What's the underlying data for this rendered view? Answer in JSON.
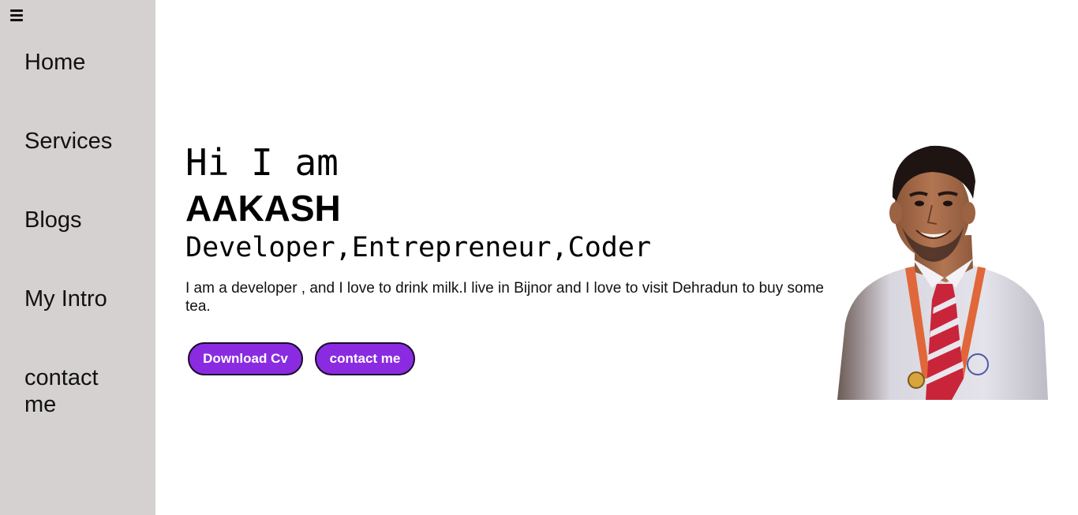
{
  "sidebar": {
    "menu_icon": "hamburger-menu-icon",
    "items": [
      {
        "label": "Home"
      },
      {
        "label": "Services"
      },
      {
        "label": "Blogs"
      },
      {
        "label": "My Intro"
      },
      {
        "label": "contact me"
      }
    ]
  },
  "hero": {
    "greeting": "Hi I am",
    "name": "AAKASH",
    "roles": "Developer,Entrepreneur,Coder",
    "intro": "I am a developer , and I love to drink milk.I live in Bijnor and I love to visit Dehradun to buy some tea.",
    "buttons": {
      "download_cv": "Download Cv",
      "contact": "contact me"
    },
    "photo": "profile-photo"
  },
  "colors": {
    "sidebar_bg": "#d5d1d1",
    "button_bg": "#8a2be2",
    "button_text": "#ffffff",
    "page_bg": "#ffffff"
  }
}
